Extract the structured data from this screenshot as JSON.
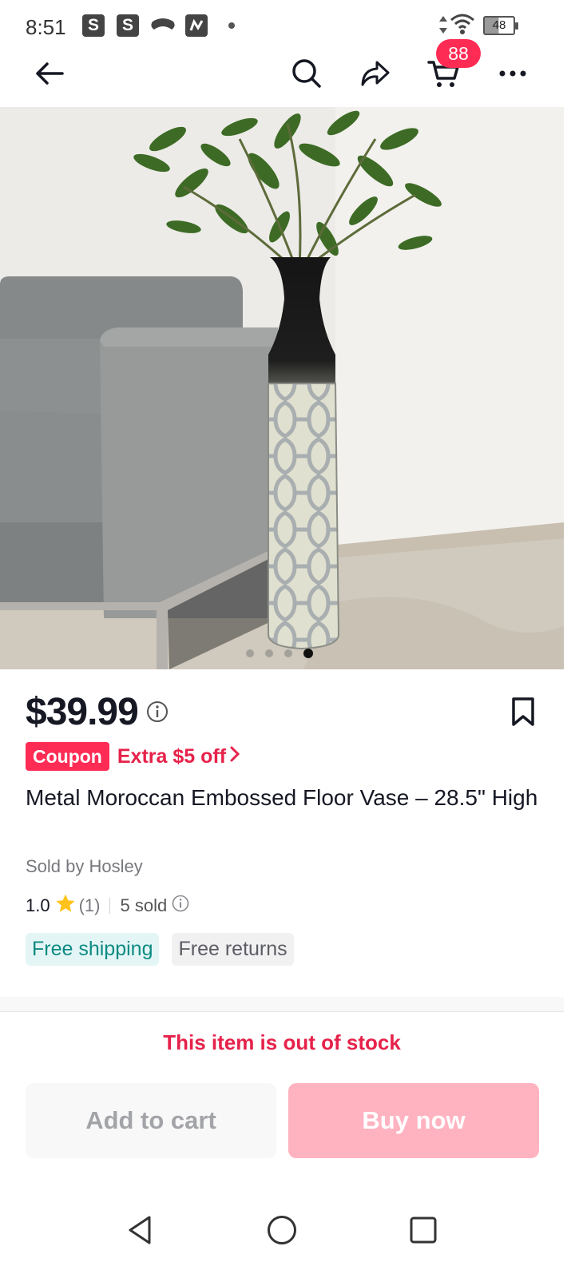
{
  "status_bar": {
    "time": "8:51",
    "notification_icons": [
      "S",
      "S"
    ],
    "battery_level": "48"
  },
  "header": {
    "cart_badge_count": "88"
  },
  "product": {
    "price": "$39.99",
    "coupon_badge": "Coupon",
    "coupon_text": "Extra $5 off",
    "title": "Metal Moroccan Embossed Floor Vase – 28.5\" High",
    "sold_by": "Sold by Hosley",
    "rating": "1.0",
    "rating_count": "(1)",
    "sold_count": "5 sold",
    "chips": {
      "shipping": "Free shipping",
      "returns": "Free returns"
    },
    "image_carousel": {
      "total": 4,
      "active_index": 3
    }
  },
  "availability": {
    "message": "This item is out of stock"
  },
  "actions": {
    "add_to_cart": "Add to cart",
    "buy_now": "Buy now"
  },
  "colors": {
    "accent": "#fe2c55",
    "out_of_stock": "#e6224a",
    "shipping_chip_text": "#0c8a83"
  }
}
